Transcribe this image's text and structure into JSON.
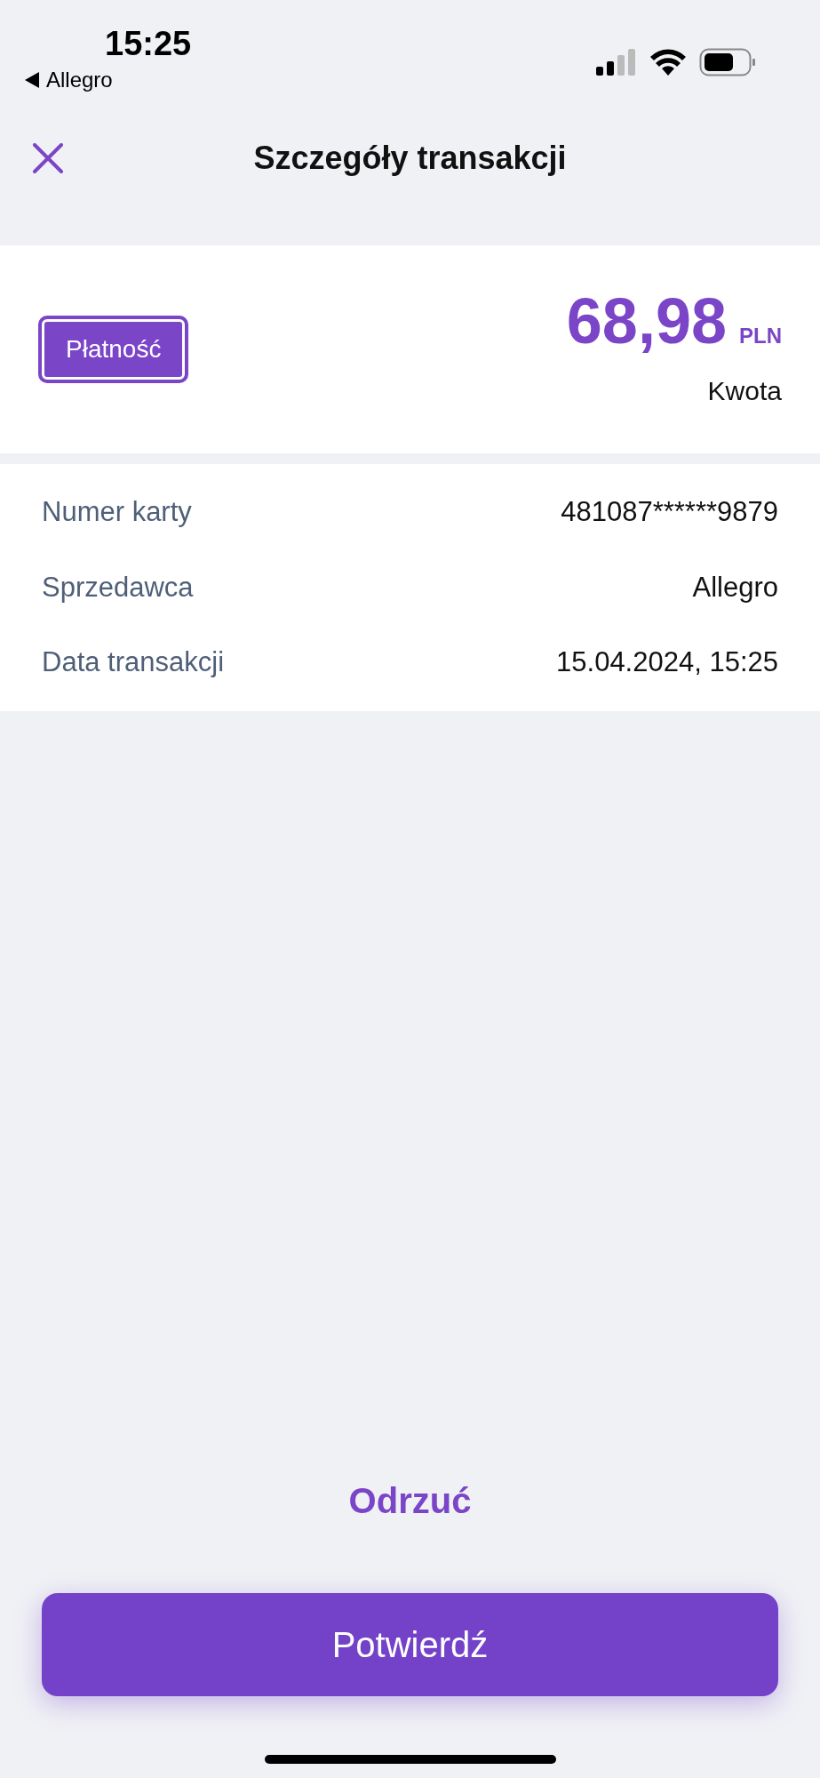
{
  "status_bar": {
    "time": "15:25",
    "back_app": "Allegro"
  },
  "header": {
    "title": "Szczegóły transakcji"
  },
  "summary": {
    "badge": "Płatność",
    "amount": "68,98",
    "currency": "PLN",
    "amount_label": "Kwota"
  },
  "details": [
    {
      "label": "Numer karty",
      "value": "481087******9879"
    },
    {
      "label": "Sprzedawca",
      "value": "Allegro"
    },
    {
      "label": "Data transakcji",
      "value": "15.04.2024, 15:25"
    }
  ],
  "actions": {
    "reject": "Odrzuć",
    "confirm": "Potwierdź"
  }
}
